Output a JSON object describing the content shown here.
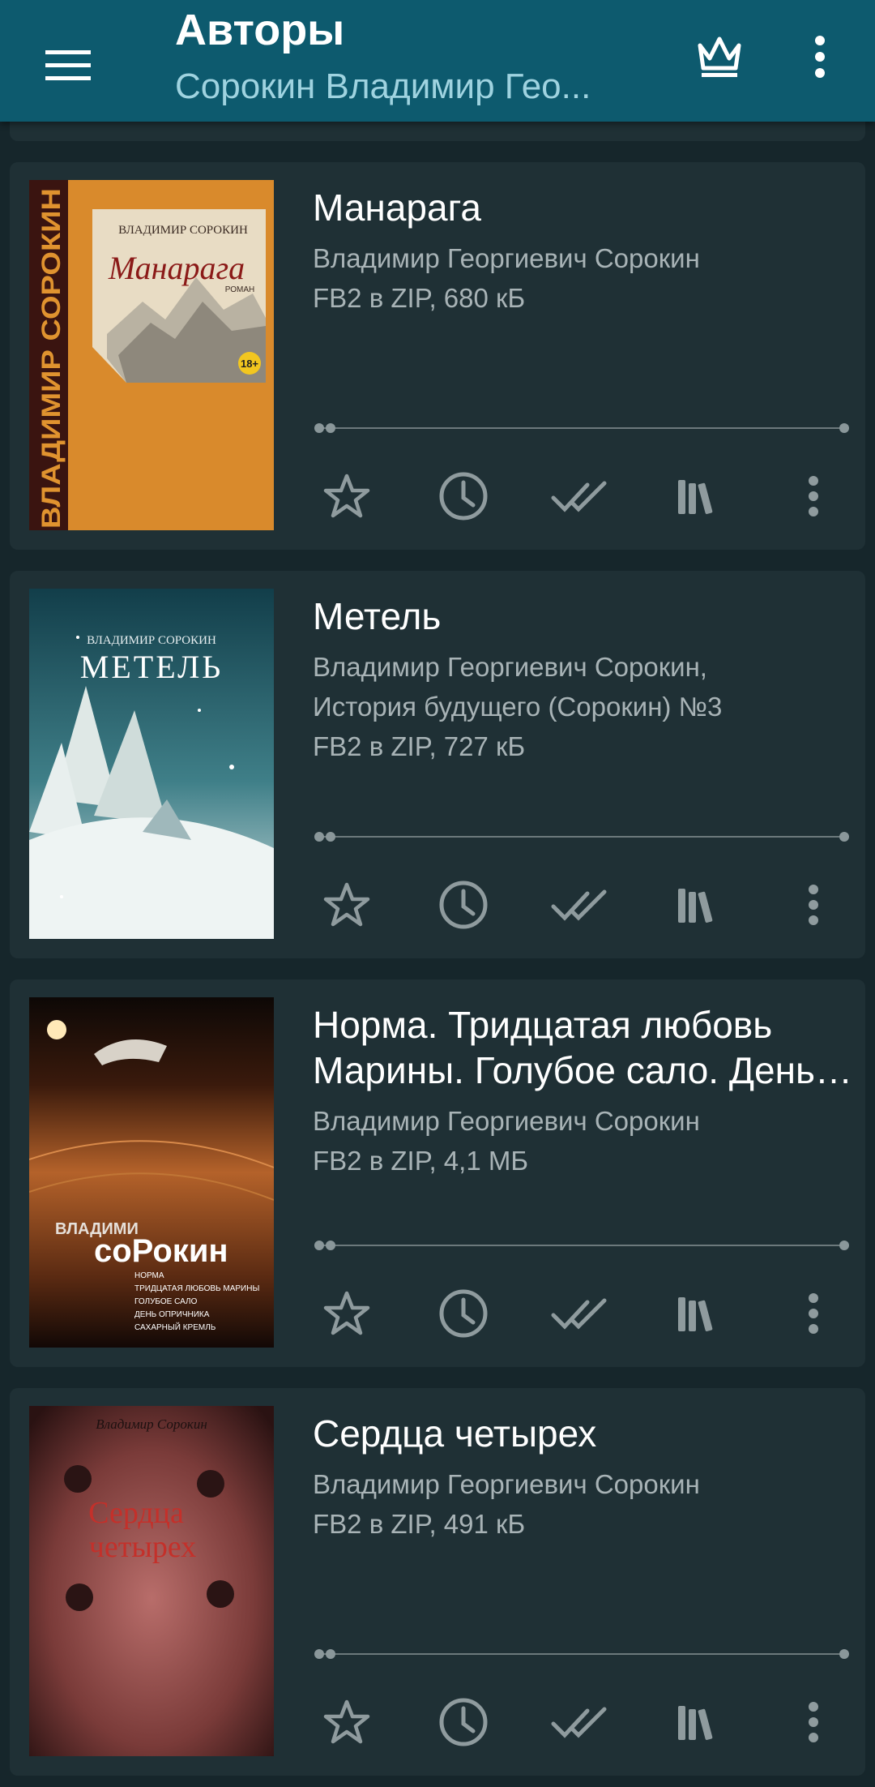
{
  "app_bar": {
    "title": "Авторы",
    "subtitle": "Сорокин Владимир Гео..."
  },
  "colors": {
    "app_bar": "#0d5a6e",
    "background": "#16262b",
    "card": "#1f3035",
    "icon": "#8f9b9e",
    "secondary_text": "#a8b3b6"
  },
  "icons": {
    "menu": "hamburger-menu-icon",
    "premium": "crown-icon",
    "overflow": "vertical-dots-icon",
    "favorite": "star-outline-icon",
    "read_later": "clock-icon",
    "mark_read": "double-check-icon",
    "bookshelf": "books-icon",
    "item_menu": "vertical-dots-icon"
  },
  "books": [
    {
      "title": "Манарага",
      "meta": [
        "Владимир Георгиевич Сорокин",
        "FB2 в ZIP, 680 кБ"
      ],
      "cover": {
        "spine_text": "ВЛАДИМИР СОРОКИН",
        "author_text": "ВЛАДИМИР СОРОКИН",
        "title_text": "Манарага",
        "subtitle_text": "РОМАН",
        "age_badge": "18+"
      }
    },
    {
      "title": "Метель",
      "meta": [
        "Владимир Георгиевич Сорокин,",
        "История будущего (Сорокин) №3",
        "FB2 в ZIP, 727 кБ"
      ],
      "cover": {
        "author_text": "ВЛАДИМИР СОРОКИН",
        "title_text": "МЕТЕЛЬ"
      }
    },
    {
      "title": "Норма. Тридцатая любовь Марины. Голубое сало. День опричника. Сахарный кремль",
      "meta": [
        "Владимир Георгиевич Сорокин",
        "FB2 в ZIP, 4,1 МБ"
      ],
      "cover": {
        "author_line1": "ВЛАДИМИ",
        "author_line2": "соРокин",
        "contents": [
          "НОРМА",
          "ТРИДЦАТАЯ ЛЮБОВЬ МАРИНЫ",
          "ГОЛУБОЕ САЛО",
          "ДЕНЬ ОПРИЧНИКА",
          "САХАРНЫЙ КРЕМЛЬ"
        ]
      }
    },
    {
      "title": "Сердца четырех",
      "meta": [
        "Владимир Георгиевич Сорокин",
        "FB2 в ZIP, 491 кБ"
      ],
      "cover": {
        "author_text": "Владимир Сорокин",
        "title_line1": "Сердца",
        "title_line2": "четырех"
      }
    }
  ]
}
